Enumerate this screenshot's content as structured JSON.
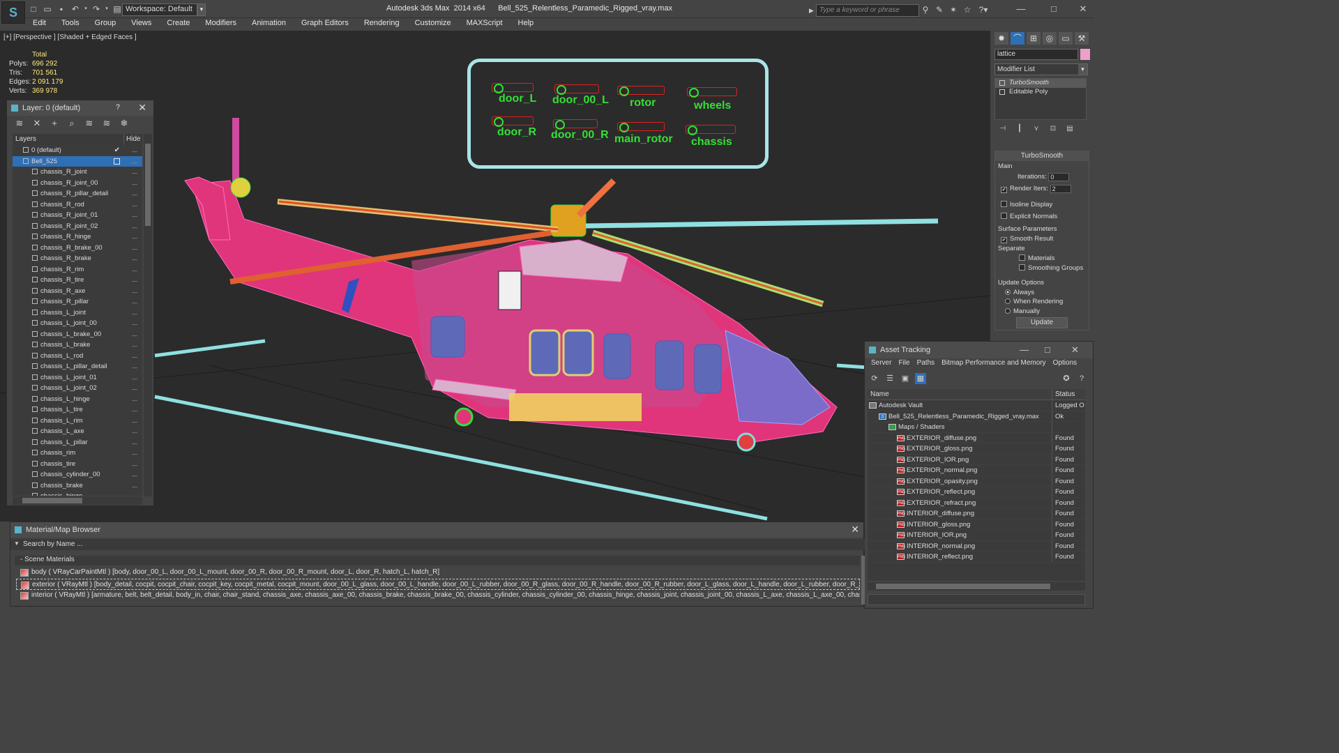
{
  "titlebar": {
    "app_title": "Autodesk 3ds Max  2014 x64      Bell_525_Relentless_Paramedic_Rigged_vray.max",
    "workspace": "Workspace: Default",
    "search_placeholder": "Type a keyword or phrase"
  },
  "menu": [
    "Edit",
    "Tools",
    "Group",
    "Views",
    "Create",
    "Modifiers",
    "Animation",
    "Graph Editors",
    "Rendering",
    "Customize",
    "MAXScript",
    "Help"
  ],
  "viewport": {
    "label": "[+] [Perspective ] [Shaded + Edged Faces ]",
    "stats": {
      "total_label": "Total",
      "rows": [
        {
          "k": "Polys:",
          "v": "696 292"
        },
        {
          "k": "Tris:",
          "v": "701 561"
        },
        {
          "k": "Edges:",
          "v": "2 091 179"
        },
        {
          "k": "Verts:",
          "v": "369 978"
        }
      ]
    },
    "controls": [
      "door_L",
      "door_00_L",
      "rotor",
      "wheels",
      "door_R",
      "door_00_R",
      "main_rotor",
      "chassis"
    ]
  },
  "layer_panel": {
    "title": "Layer: 0 (default)",
    "help": "?",
    "col_layers": "Layers",
    "col_hide": "Hide",
    "default_layer": "0 (default)",
    "selected_layer": "Bell_525",
    "items": [
      "chassis_R_joint",
      "chassis_R_joint_00",
      "chassis_R_pillar_detail",
      "chassis_R_rod",
      "chassis_R_joint_01",
      "chassis_R_joint_02",
      "chassis_R_hinge",
      "chassis_R_brake_00",
      "chassis_R_brake",
      "chassis_R_rim",
      "chassis_R_tire",
      "chassis_R_axe",
      "chassis_R_pillar",
      "chassis_L_joint",
      "chassis_L_joint_00",
      "chassis_L_brake_00",
      "chassis_L_brake",
      "chassis_L_rod",
      "chassis_L_pillar_detail",
      "chassis_L_joint_01",
      "chassis_L_joint_02",
      "chassis_L_hinge",
      "chassis_L_tire",
      "chassis_L_rim",
      "chassis_L_axe",
      "chassis_L_pillar",
      "chassis_rim",
      "chassis_tire",
      "chassis_cylinder_00",
      "chassis_brake",
      "chassis_hinge"
    ]
  },
  "command_panel": {
    "object_name": "lattice",
    "modifier_list": "Modifier List",
    "stack": [
      "TurboSmooth",
      "Editable Poly"
    ],
    "rollout_title": "TurboSmooth",
    "main_label": "Main",
    "iterations_label": "Iterations:",
    "iterations_value": "0",
    "render_iters_label": "Render Iters:",
    "render_iters_value": "2",
    "isoline_label": "Isoline Display",
    "explicit_normals_label": "Explicit Normals",
    "surface_params_label": "Surface Parameters",
    "smooth_result_label": "Smooth Result",
    "separate_label": "Separate",
    "materials_label": "Materials",
    "smoothing_groups_label": "Smoothing Groups",
    "update_options_label": "Update Options",
    "always_label": "Always",
    "when_rendering_label": "When Rendering",
    "manually_label": "Manually",
    "update_button": "Update"
  },
  "asset_tracking": {
    "title": "Asset Tracking",
    "menu": [
      "Server",
      "File",
      "Paths",
      "Bitmap Performance and Memory",
      "Options"
    ],
    "col_name": "Name",
    "col_status": "Status",
    "rows": [
      {
        "name": "Autodesk Vault",
        "status": "Logged O",
        "level": 0,
        "type": "vault"
      },
      {
        "name": "Bell_525_Relentless_Paramedic_Rigged_vray.max",
        "status": "Ok",
        "level": 1,
        "type": "max"
      },
      {
        "name": "Maps / Shaders",
        "status": "",
        "level": 2,
        "type": "folder"
      },
      {
        "name": "EXTERIOR_diffuse.png",
        "status": "Found",
        "level": 3,
        "type": "png"
      },
      {
        "name": "EXTERIOR_gloss.png",
        "status": "Found",
        "level": 3,
        "type": "png"
      },
      {
        "name": "EXTERIOR_IOR.png",
        "status": "Found",
        "level": 3,
        "type": "png"
      },
      {
        "name": "EXTERIOR_normal.png",
        "status": "Found",
        "level": 3,
        "type": "png"
      },
      {
        "name": "EXTERIOR_opasity.png",
        "status": "Found",
        "level": 3,
        "type": "png"
      },
      {
        "name": "EXTERIOR_reflect.png",
        "status": "Found",
        "level": 3,
        "type": "png"
      },
      {
        "name": "EXTERIOR_refract.png",
        "status": "Found",
        "level": 3,
        "type": "png"
      },
      {
        "name": "INTERIOR_diffuse.png",
        "status": "Found",
        "level": 3,
        "type": "png"
      },
      {
        "name": "INTERIOR_gloss.png",
        "status": "Found",
        "level": 3,
        "type": "png"
      },
      {
        "name": "INTERIOR_IOR.png",
        "status": "Found",
        "level": 3,
        "type": "png"
      },
      {
        "name": "INTERIOR_normal.png",
        "status": "Found",
        "level": 3,
        "type": "png"
      },
      {
        "name": "INTERIOR_reflect.png",
        "status": "Found",
        "level": 3,
        "type": "png"
      }
    ]
  },
  "material_browser": {
    "title": "Material/Map Browser",
    "search": "Search by Name ...",
    "group": "- Scene Materials",
    "rows": [
      "body  ( VRayCarPaintMtl )  [body, door_00_L, door_00_L_mount, door_00_R, door_00_R_mount, door_L, door_R, hatch_L, hatch_R]",
      "exterior ( VRayMtl ) [body_detail, cocpit, cocpit_chair, cocpit_key, cocpit_metal, cocpit_mount, door_00_L_glass, door_00_L_handle, door_00_L_rubber, door_00_R_glass, door_00_R_handle, door_00_R_rubber, door_L_glass, door_L_handle, door_L_rubber, door_R_glass, door_R_ha...",
      "interior ( VRayMtl ) [armature, belt, belt_detail, body_in, chair, chair_stand, chassis_axe, chassis_axe_00, chassis_brake, chassis_brake_00, chassis_cylinder, chassis_cylinder_00, chassis_hinge, chassis_joint, chassis_joint_00, chassis_L_axe, chassis_L_axe_00, chassis_L_brake, chassi..."
    ]
  }
}
